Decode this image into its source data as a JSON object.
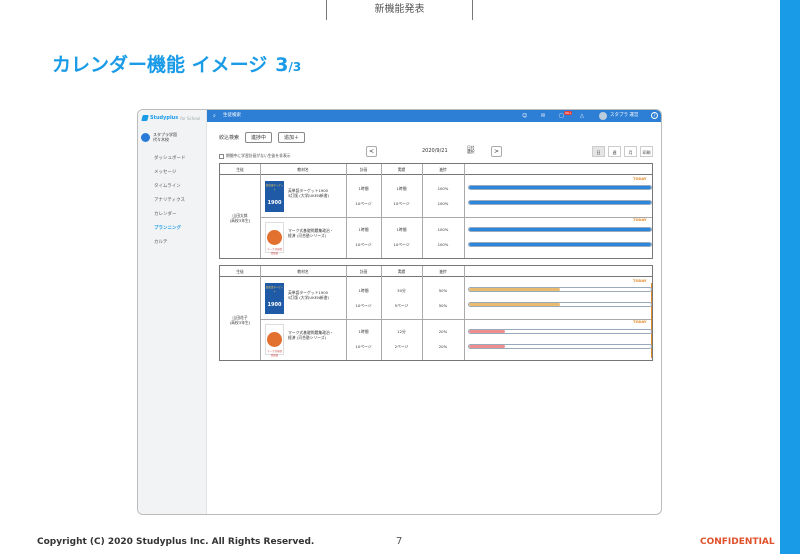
{
  "slide": {
    "top_tab": "新機能発表",
    "title": "カレンダー機能 イメージ",
    "page_big": "3",
    "page_small": "/3",
    "copyright": "Copyright (C) 2020 Studyplus Inc.  All Rights Reserved.",
    "page_number": "7",
    "confidential": "CONFIDENTIAL"
  },
  "colors": {
    "accent": "#1a9be8",
    "topbar": "#2d7fd6",
    "today": "#e08a2a",
    "progress_blue": "#2d86dc",
    "progress_orange": "#e8bb6e",
    "progress_red": "#ef8e8e"
  },
  "app": {
    "logo": "Studyplus",
    "logo_sub": "for School",
    "school_line1": "スタプラ学園",
    "school_line2": "代々木校",
    "sidebar": [
      "ダッシュボード",
      "メッセージ",
      "タイムライン",
      "アナリティクス",
      "カレンダー",
      "プランニング",
      "カルテ"
    ],
    "topbar": {
      "search_icon": "search-icon",
      "search_label": "生徒検索",
      "user_name": "スタプラ 運営",
      "help": "?",
      "notif_count": "99+"
    },
    "filter": {
      "label": "絞込検索",
      "chip": "進捗中",
      "add": "追加＋"
    },
    "checkbox_label": "期間中に学習計画がない生徒を非表示",
    "date_nav": {
      "prev": "<",
      "date": "2020/9/21",
      "select_line1": "日付",
      "select_line2": "選択",
      "next": ">"
    },
    "views": [
      "日",
      "週",
      "月",
      "印刷"
    ],
    "headers": {
      "student": "生徒",
      "material": "教材名",
      "plan": "計画",
      "actual": "実績",
      "progress": "進捗"
    },
    "today_label": "TODAY",
    "students": [
      {
        "name_line1": "山田太郎",
        "name_line2": "(高校3年生)",
        "rows": [
          {
            "book_title": "1900",
            "book_sub": "英単語ターゲット",
            "title_line1": "英単語ターゲット1900",
            "title_line2": "5訂版 (大学JUKEN新書)",
            "plan1": "1時間",
            "plan2": "10ページ",
            "actual1": "1時間",
            "actual2": "10ページ",
            "prog1": "100%",
            "prog2": "100%",
            "bar1": 1.0,
            "bar2": 1.0
          },
          {
            "book_title": "",
            "book_sub": "マーク式基礎問題集",
            "title_line1": "マーク式基礎問題集政治・",
            "title_line2": "経済 (河合塾シリーズ)",
            "plan1": "1時間",
            "plan2": "10ページ",
            "actual1": "1時間",
            "actual2": "10ページ",
            "prog1": "100%",
            "prog2": "100%",
            "bar1": 1.0,
            "bar2": 1.0
          }
        ]
      },
      {
        "name_line1": "山田花子",
        "name_line2": "(高校3年生)",
        "rows": [
          {
            "book_title": "1900",
            "book_sub": "英単語ターゲット",
            "title_line1": "英単語ターゲット1900",
            "title_line2": "5訂版 (大学JUKEN新書)",
            "plan1": "1時間",
            "plan2": "10ページ",
            "actual1": "30分",
            "actual2": "5ページ",
            "prog1": "50%",
            "prog2": "50%",
            "bar1": 0.5,
            "bar2": 0.5
          },
          {
            "book_title": "",
            "book_sub": "マーク式基礎問題集",
            "title_line1": "マーク式基礎問題集政治・",
            "title_line2": "経済 (河合塾シリーズ)",
            "plan1": "1時間",
            "plan2": "10ページ",
            "actual1": "12分",
            "actual2": "2ページ",
            "prog1": "20%",
            "prog2": "20%",
            "bar1": 0.2,
            "bar2": 0.2
          }
        ]
      }
    ]
  }
}
